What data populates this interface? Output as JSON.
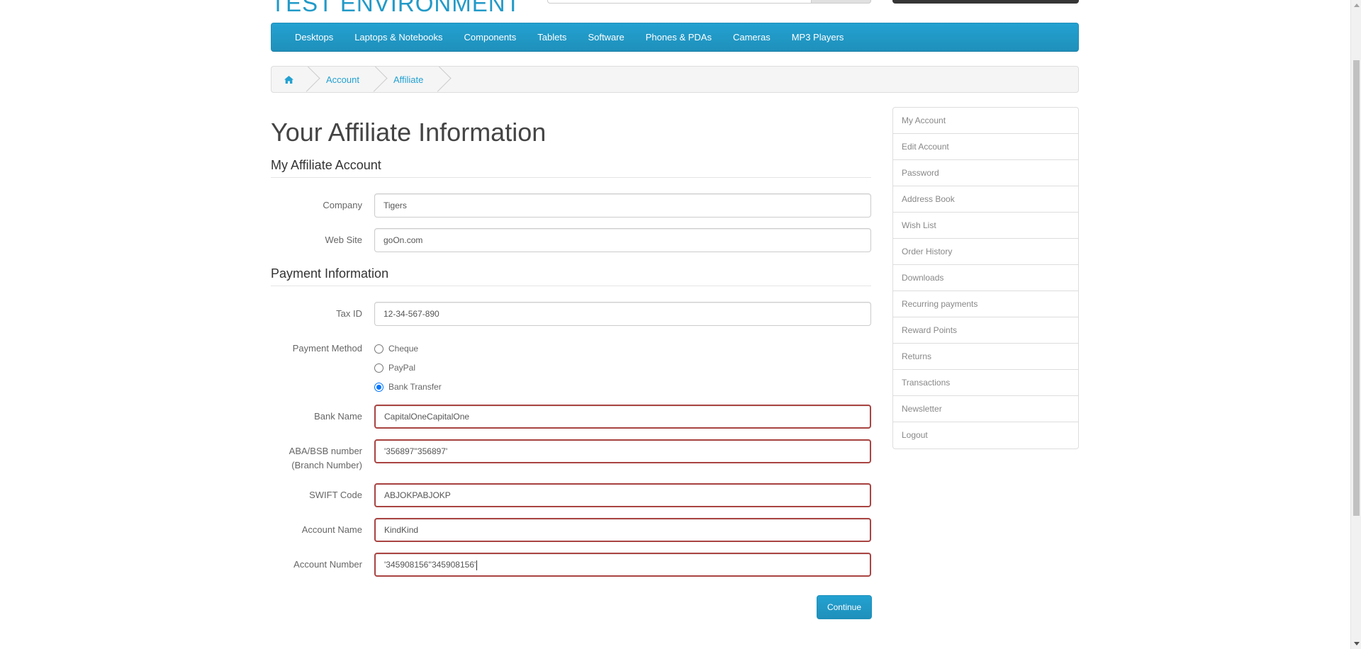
{
  "header": {
    "logo_text": "TEST ENVIRONMENT"
  },
  "menu": {
    "items": [
      {
        "label": "Desktops"
      },
      {
        "label": "Laptops & Notebooks"
      },
      {
        "label": "Components"
      },
      {
        "label": "Tablets"
      },
      {
        "label": "Software"
      },
      {
        "label": "Phones & PDAs"
      },
      {
        "label": "Cameras"
      },
      {
        "label": "MP3 Players"
      }
    ]
  },
  "breadcrumb": {
    "home_icon": "home-icon",
    "items": [
      {
        "label": "Account"
      },
      {
        "label": "Affiliate"
      }
    ]
  },
  "page": {
    "title": "Your Affiliate Information",
    "section_affiliate": "My Affiliate Account",
    "section_payment": "Payment Information"
  },
  "form": {
    "company": {
      "label": "Company",
      "value": "Tigers"
    },
    "website": {
      "label": "Web Site",
      "value": "goOn.com"
    },
    "tax_id": {
      "label": "Tax ID",
      "value": "12-34-567-890"
    },
    "payment_method": {
      "label": "Payment Method",
      "options": [
        {
          "label": "Cheque",
          "checked": false
        },
        {
          "label": "PayPal",
          "checked": false
        },
        {
          "label": "Bank Transfer",
          "checked": true
        }
      ]
    },
    "bank_name": {
      "label": "Bank Name",
      "value": "CapitalOneCapitalOne"
    },
    "aba_bsb": {
      "label_line1": "ABA/BSB number",
      "label_line2": "(Branch Number)",
      "value": "'356897''356897'"
    },
    "swift": {
      "label": "SWIFT Code",
      "value": "ABJOKPABJOKP"
    },
    "account_name": {
      "label": "Account Name",
      "value": "KindKind"
    },
    "account_number": {
      "label": "Account Number",
      "value": "'345908156''345908156'"
    },
    "error_color": "#a94442",
    "continue_label": "Continue"
  },
  "sidebar": {
    "items": [
      {
        "label": "My Account"
      },
      {
        "label": "Edit Account"
      },
      {
        "label": "Password"
      },
      {
        "label": "Address Book"
      },
      {
        "label": "Wish List"
      },
      {
        "label": "Order History"
      },
      {
        "label": "Downloads"
      },
      {
        "label": "Recurring payments"
      },
      {
        "label": "Reward Points"
      },
      {
        "label": "Returns"
      },
      {
        "label": "Transactions"
      },
      {
        "label": "Newsletter"
      },
      {
        "label": "Logout"
      }
    ]
  },
  "colors": {
    "accent": "#229ac8",
    "menu_bg": "#1f90bb"
  }
}
